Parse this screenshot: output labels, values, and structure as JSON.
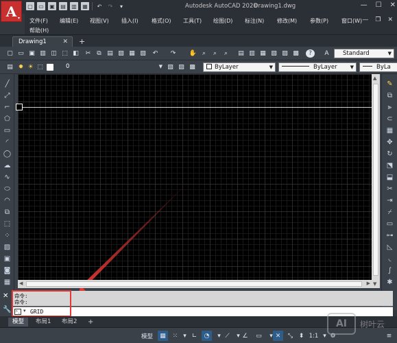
{
  "app": {
    "title": "Autodesk AutoCAD 2020",
    "document": "Drawing1.dwg",
    "logo_letter": "A"
  },
  "menu": {
    "items": [
      "文件(F)",
      "编辑(E)",
      "视图(V)",
      "插入(I)",
      "格式(O)",
      "工具(T)",
      "绘图(D)",
      "标注(N)",
      "修改(M)",
      "参数(P)",
      "窗口(W)",
      "帮助(H)"
    ]
  },
  "tabs": {
    "active": "Drawing1"
  },
  "toolbar": {
    "text_style": "Standard",
    "layer": "0",
    "color": "ByLayer",
    "linetype": "ByLayer",
    "lineweight": "ByLa"
  },
  "command": {
    "history": [
      "命令:",
      "命令:"
    ],
    "input": "GRID"
  },
  "layouts": {
    "tabs": [
      "模型",
      "布局1",
      "布局2"
    ],
    "add": "+"
  },
  "status": {
    "model": "模型",
    "scale": "1:1"
  },
  "watermark": {
    "logo": "AI",
    "text": "树叶云"
  },
  "colors": {
    "accent_red": "#e53935",
    "canvas_bg": "#000000",
    "ui_dark": "#3b4149"
  }
}
